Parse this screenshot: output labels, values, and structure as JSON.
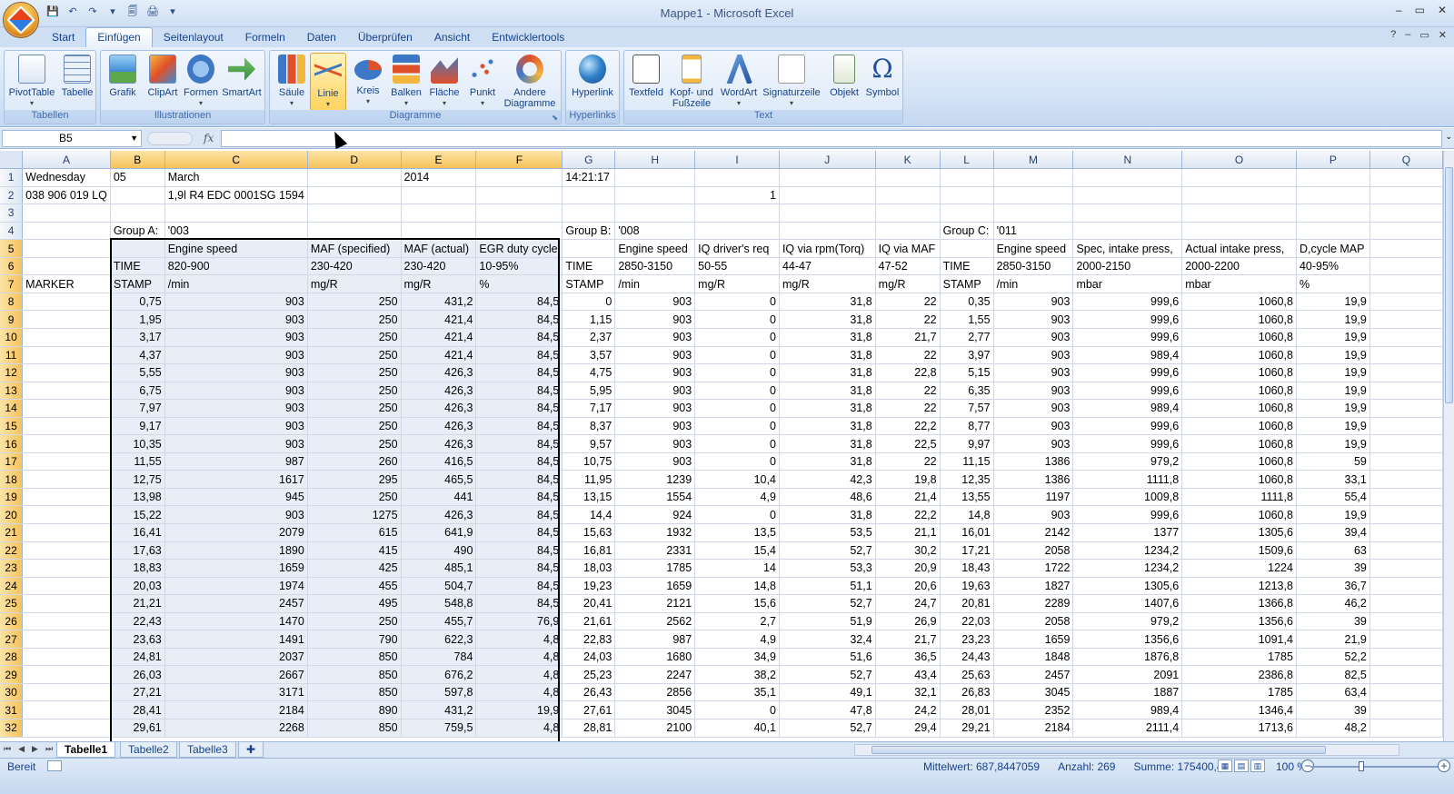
{
  "window": {
    "title": "Mappe1 - Microsoft Excel",
    "min": "–",
    "restore": "▭",
    "close": "✕"
  },
  "qat": [
    "💾",
    "↶",
    "↷",
    "▾",
    "🗐",
    "🖨",
    "▾"
  ],
  "ribbon_tabs": [
    "Start",
    "Einfügen",
    "Seitenlayout",
    "Formeln",
    "Daten",
    "Überprüfen",
    "Ansicht",
    "Entwicklertools"
  ],
  "active_tab": "Einfügen",
  "help": {
    "help": "?",
    "min": "–",
    "restore": "▭",
    "close": "✕"
  },
  "groups": {
    "tabellen": {
      "caption": "Tabellen",
      "buttons": [
        "PivotTable",
        "Tabelle"
      ]
    },
    "illustrationen": {
      "caption": "Illustrationen",
      "buttons": [
        "Grafik",
        "ClipArt",
        "Formen",
        "SmartArt"
      ]
    },
    "diagramme": {
      "caption": "Diagramme",
      "buttons": [
        "Säule",
        "Linie",
        "Kreis",
        "Balken",
        "Fläche",
        "Punkt",
        "Andere Diagramme"
      ]
    },
    "hyperlinks": {
      "caption": "Hyperlinks",
      "buttons": [
        "Hyperlink"
      ]
    },
    "text": {
      "caption": "Text",
      "buttons": [
        "Textfeld",
        "Kopf- und Fußzeile",
        "WordArt",
        "Signaturzeile",
        "Objekt",
        "Symbol"
      ]
    }
  },
  "namebox": "B5",
  "fx": "fx",
  "columns": [
    "A",
    "B",
    "C",
    "D",
    "E",
    "F",
    "G",
    "H",
    "I",
    "J",
    "K",
    "L",
    "M",
    "N",
    "O",
    "P",
    "Q"
  ],
  "rows": [
    [
      "Wednesday",
      "05",
      "March",
      "",
      "2014",
      "",
      "14:21:17",
      "",
      "",
      "",
      "",
      "",
      "",
      "",
      "",
      "",
      ""
    ],
    [
      "038 906 019 LQ",
      "",
      "1,9l R4 EDC 0001SG  1594",
      "",
      "",
      "",
      "",
      "",
      "1",
      "",
      "",
      "",
      "",
      "",
      "",
      "",
      ""
    ],
    [
      "",
      "",
      "",
      "",
      "",
      "",
      "",
      "",
      "",
      "",
      "",
      "",
      "",
      "",
      "",
      "",
      ""
    ],
    [
      "",
      "Group A:",
      "'003",
      "",
      "",
      "",
      "Group B:",
      "'008",
      "",
      "",
      "",
      "Group C:",
      "'011",
      "",
      "",
      "",
      ""
    ],
    [
      "",
      "",
      "Engine speed",
      "MAF (specified)",
      "MAF (actual)",
      "EGR duty cycle",
      "",
      "Engine speed",
      "IQ driver's req",
      "IQ via rpm(Torq)",
      "IQ via MAF",
      "",
      "Engine speed",
      "Spec, intake press,",
      "Actual intake press,",
      "D,cycle MAP",
      ""
    ],
    [
      "",
      "TIME",
      "820-900",
      "230-420",
      "230-420",
      "10-95%",
      "TIME",
      "2850-3150",
      "50-55",
      "44-47",
      "47-52",
      "TIME",
      "2850-3150",
      "2000-2150",
      "2000-2200",
      "40-95%",
      ""
    ],
    [
      "MARKER",
      "STAMP",
      " /min",
      " mg/R",
      " mg/R",
      " %",
      "STAMP",
      " /min",
      " mg/R",
      " mg/R",
      " mg/R",
      "STAMP",
      " /min",
      " mbar",
      " mbar",
      " %",
      ""
    ],
    [
      "",
      "0,75",
      "903",
      "250",
      "431,2",
      "84,5",
      "0",
      "903",
      "0",
      "31,8",
      "22",
      "0,35",
      "903",
      "999,6",
      "1060,8",
      "19,9",
      ""
    ],
    [
      "",
      "1,95",
      "903",
      "250",
      "421,4",
      "84,5",
      "1,15",
      "903",
      "0",
      "31,8",
      "22",
      "1,55",
      "903",
      "999,6",
      "1060,8",
      "19,9",
      ""
    ],
    [
      "",
      "3,17",
      "903",
      "250",
      "421,4",
      "84,5",
      "2,37",
      "903",
      "0",
      "31,8",
      "21,7",
      "2,77",
      "903",
      "999,6",
      "1060,8",
      "19,9",
      ""
    ],
    [
      "",
      "4,37",
      "903",
      "250",
      "421,4",
      "84,5",
      "3,57",
      "903",
      "0",
      "31,8",
      "22",
      "3,97",
      "903",
      "989,4",
      "1060,8",
      "19,9",
      ""
    ],
    [
      "",
      "5,55",
      "903",
      "250",
      "426,3",
      "84,5",
      "4,75",
      "903",
      "0",
      "31,8",
      "22,8",
      "5,15",
      "903",
      "999,6",
      "1060,8",
      "19,9",
      ""
    ],
    [
      "",
      "6,75",
      "903",
      "250",
      "426,3",
      "84,5",
      "5,95",
      "903",
      "0",
      "31,8",
      "22",
      "6,35",
      "903",
      "999,6",
      "1060,8",
      "19,9",
      ""
    ],
    [
      "",
      "7,97",
      "903",
      "250",
      "426,3",
      "84,5",
      "7,17",
      "903",
      "0",
      "31,8",
      "22",
      "7,57",
      "903",
      "989,4",
      "1060,8",
      "19,9",
      ""
    ],
    [
      "",
      "9,17",
      "903",
      "250",
      "426,3",
      "84,5",
      "8,37",
      "903",
      "0",
      "31,8",
      "22,2",
      "8,77",
      "903",
      "999,6",
      "1060,8",
      "19,9",
      ""
    ],
    [
      "",
      "10,35",
      "903",
      "250",
      "426,3",
      "84,5",
      "9,57",
      "903",
      "0",
      "31,8",
      "22,5",
      "9,97",
      "903",
      "999,6",
      "1060,8",
      "19,9",
      ""
    ],
    [
      "",
      "11,55",
      "987",
      "260",
      "416,5",
      "84,5",
      "10,75",
      "903",
      "0",
      "31,8",
      "22",
      "11,15",
      "1386",
      "979,2",
      "1060,8",
      "59",
      ""
    ],
    [
      "",
      "12,75",
      "1617",
      "295",
      "465,5",
      "84,5",
      "11,95",
      "1239",
      "10,4",
      "42,3",
      "19,8",
      "12,35",
      "1386",
      "1111,8",
      "1060,8",
      "33,1",
      ""
    ],
    [
      "",
      "13,98",
      "945",
      "250",
      "441",
      "84,5",
      "13,15",
      "1554",
      "4,9",
      "48,6",
      "21,4",
      "13,55",
      "1197",
      "1009,8",
      "1111,8",
      "55,4",
      ""
    ],
    [
      "",
      "15,22",
      "903",
      "1275",
      "426,3",
      "84,5",
      "14,4",
      "924",
      "0",
      "31,8",
      "22,2",
      "14,8",
      "903",
      "999,6",
      "1060,8",
      "19,9",
      ""
    ],
    [
      "",
      "16,41",
      "2079",
      "615",
      "641,9",
      "84,5",
      "15,63",
      "1932",
      "13,5",
      "53,5",
      "21,1",
      "16,01",
      "2142",
      "1377",
      "1305,6",
      "39,4",
      ""
    ],
    [
      "",
      "17,63",
      "1890",
      "415",
      "490",
      "84,5",
      "16,81",
      "2331",
      "15,4",
      "52,7",
      "30,2",
      "17,21",
      "2058",
      "1234,2",
      "1509,6",
      "63",
      ""
    ],
    [
      "",
      "18,83",
      "1659",
      "425",
      "485,1",
      "84,5",
      "18,03",
      "1785",
      "14",
      "53,3",
      "20,9",
      "18,43",
      "1722",
      "1234,2",
      "1224",
      "39",
      ""
    ],
    [
      "",
      "20,03",
      "1974",
      "455",
      "504,7",
      "84,5",
      "19,23",
      "1659",
      "14,8",
      "51,1",
      "20,6",
      "19,63",
      "1827",
      "1305,6",
      "1213,8",
      "36,7",
      ""
    ],
    [
      "",
      "21,21",
      "2457",
      "495",
      "548,8",
      "84,5",
      "20,41",
      "2121",
      "15,6",
      "52,7",
      "24,7",
      "20,81",
      "2289",
      "1407,6",
      "1366,8",
      "46,2",
      ""
    ],
    [
      "",
      "22,43",
      "1470",
      "250",
      "455,7",
      "76,9",
      "21,61",
      "2562",
      "2,7",
      "51,9",
      "26,9",
      "22,03",
      "2058",
      "979,2",
      "1356,6",
      "39",
      ""
    ],
    [
      "",
      "23,63",
      "1491",
      "790",
      "622,3",
      "4,8",
      "22,83",
      "987",
      "4,9",
      "32,4",
      "21,7",
      "23,23",
      "1659",
      "1356,6",
      "1091,4",
      "21,9",
      ""
    ],
    [
      "",
      "24,81",
      "2037",
      "850",
      "784",
      "4,8",
      "24,03",
      "1680",
      "34,9",
      "51,6",
      "36,5",
      "24,43",
      "1848",
      "1876,8",
      "1785",
      "52,2",
      ""
    ],
    [
      "",
      "26,03",
      "2667",
      "850",
      "676,2",
      "4,8",
      "25,23",
      "2247",
      "38,2",
      "52,7",
      "43,4",
      "25,63",
      "2457",
      "2091",
      "2386,8",
      "82,5",
      ""
    ],
    [
      "",
      "27,21",
      "3171",
      "850",
      "597,8",
      "4,8",
      "26,43",
      "2856",
      "35,1",
      "49,1",
      "32,1",
      "26,83",
      "3045",
      "1887",
      "1785",
      "63,4",
      ""
    ],
    [
      "",
      "28,41",
      "2184",
      "890",
      "431,2",
      "19,9",
      "27,61",
      "3045",
      "0",
      "47,8",
      "24,2",
      "28,01",
      "2352",
      "989,4",
      "1346,4",
      "39",
      ""
    ],
    [
      "",
      "29,61",
      "2268",
      "850",
      "759,5",
      "4,8",
      "28,81",
      "2100",
      "40,1",
      "52,7",
      "29,4",
      "29,21",
      "2184",
      "2111,4",
      "1713,6",
      "48,2",
      ""
    ]
  ],
  "sheets": [
    "Tabelle1",
    "Tabelle2",
    "Tabelle3"
  ],
  "status": {
    "ready": "Bereit",
    "avg": "Mittelwert: 687,8447059",
    "count": "Anzahl: 269",
    "sum": "Summe: 175400,4",
    "zoom": "100 %"
  }
}
